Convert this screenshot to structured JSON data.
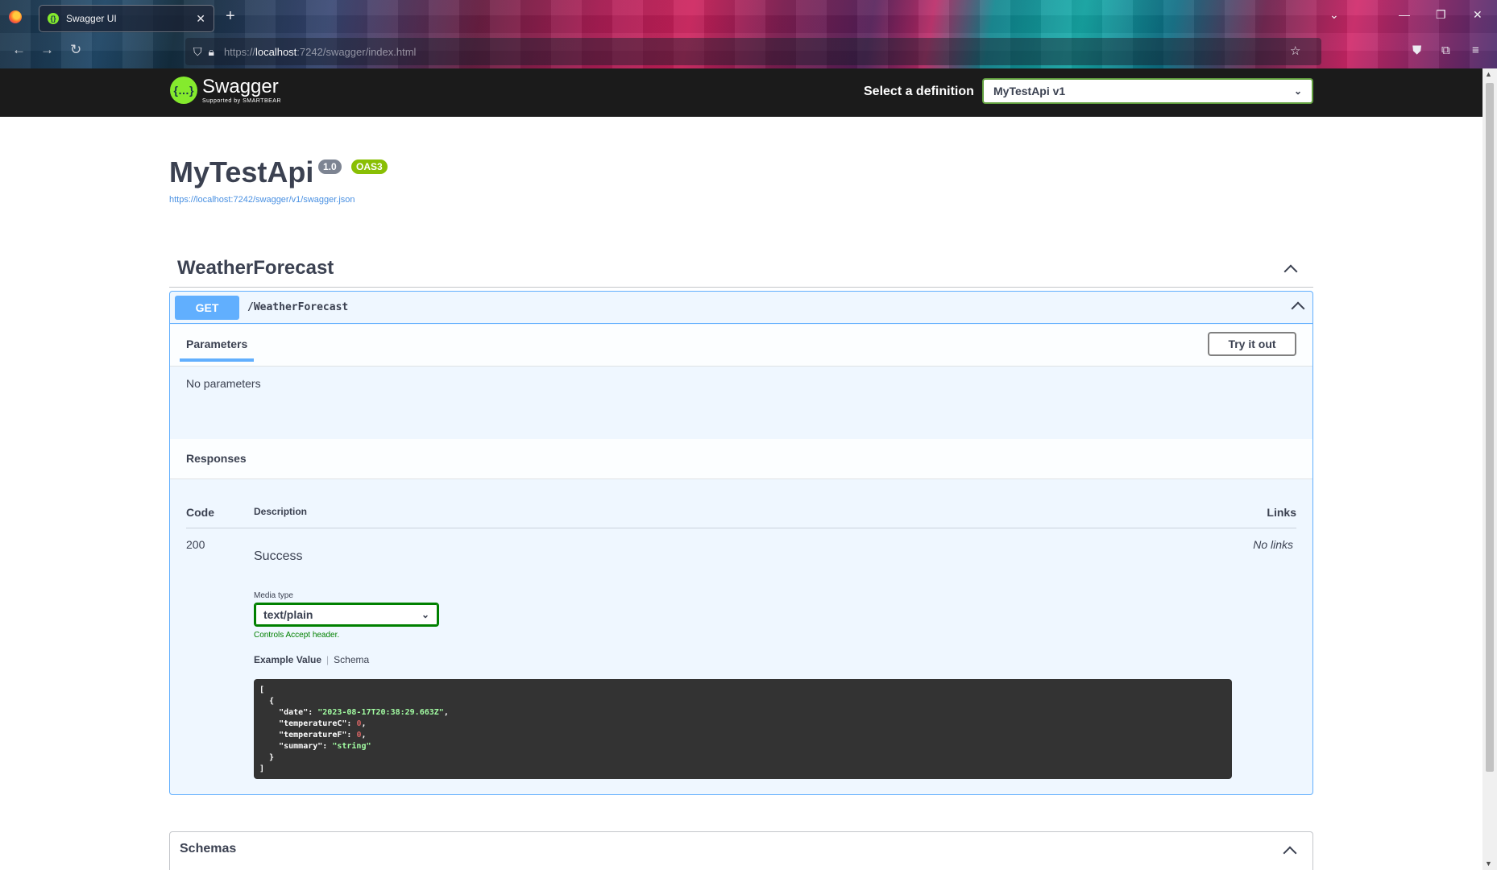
{
  "browser": {
    "tab_title": "Swagger UI",
    "tab_favicon": "{}",
    "url_prefix": "https://",
    "url_host": "localhost",
    "url_rest": ":7242/swagger/index.html"
  },
  "topbar": {
    "logo_mark": "{…}",
    "logo_text": "Swagger",
    "logo_sub": "Supported by SMARTBEAR",
    "definition_label": "Select a definition",
    "definition_value": "MyTestApi v1"
  },
  "info": {
    "title": "MyTestApi",
    "version_badge": "1.0",
    "oas_badge": "OAS3",
    "spec_url": "https://localhost:7242/swagger/v1/swagger.json"
  },
  "tag": {
    "name": "WeatherForecast"
  },
  "operation": {
    "method": "GET",
    "path": "/WeatherForecast",
    "parameters_tab": "Parameters",
    "try_button": "Try it out",
    "no_params": "No parameters",
    "responses_title": "Responses",
    "columns": {
      "code": "Code",
      "description": "Description",
      "links": "Links"
    },
    "response": {
      "code": "200",
      "description": "Success",
      "links": "No links",
      "media_type_label": "Media type",
      "media_type_value": "text/plain",
      "media_type_note": "Controls Accept header.",
      "example_tab": "Example Value",
      "schema_tab": "Schema",
      "example": {
        "open_bracket": "[",
        "open_brace": "{",
        "date_key": "\"date\"",
        "date_val": "\"2023-08-17T20:38:29.663Z\"",
        "tempc_key": "\"temperatureC\"",
        "tempc_val": "0",
        "tempf_key": "\"temperatureF\"",
        "tempf_val": "0",
        "summary_key": "\"summary\"",
        "summary_val": "\"string\"",
        "close_brace": "}",
        "close_bracket": "]"
      }
    }
  },
  "schemas": {
    "title": "Schemas"
  },
  "colors": {
    "get_method": "#61affe",
    "swagger_green": "#85ea2d",
    "topbar_bg": "#1b1b1b",
    "oas_badge": "#89bf04",
    "version_badge": "#7d8492"
  },
  "icons": {
    "back": "arrow-left-icon",
    "forward": "arrow-right-icon",
    "reload": "reload-icon",
    "shield": "shield-icon",
    "lock": "lock-icon",
    "bookmark": "star-icon",
    "pocket": "pocket-icon",
    "extensions": "puzzle-icon",
    "menu": "hamburger-icon"
  }
}
